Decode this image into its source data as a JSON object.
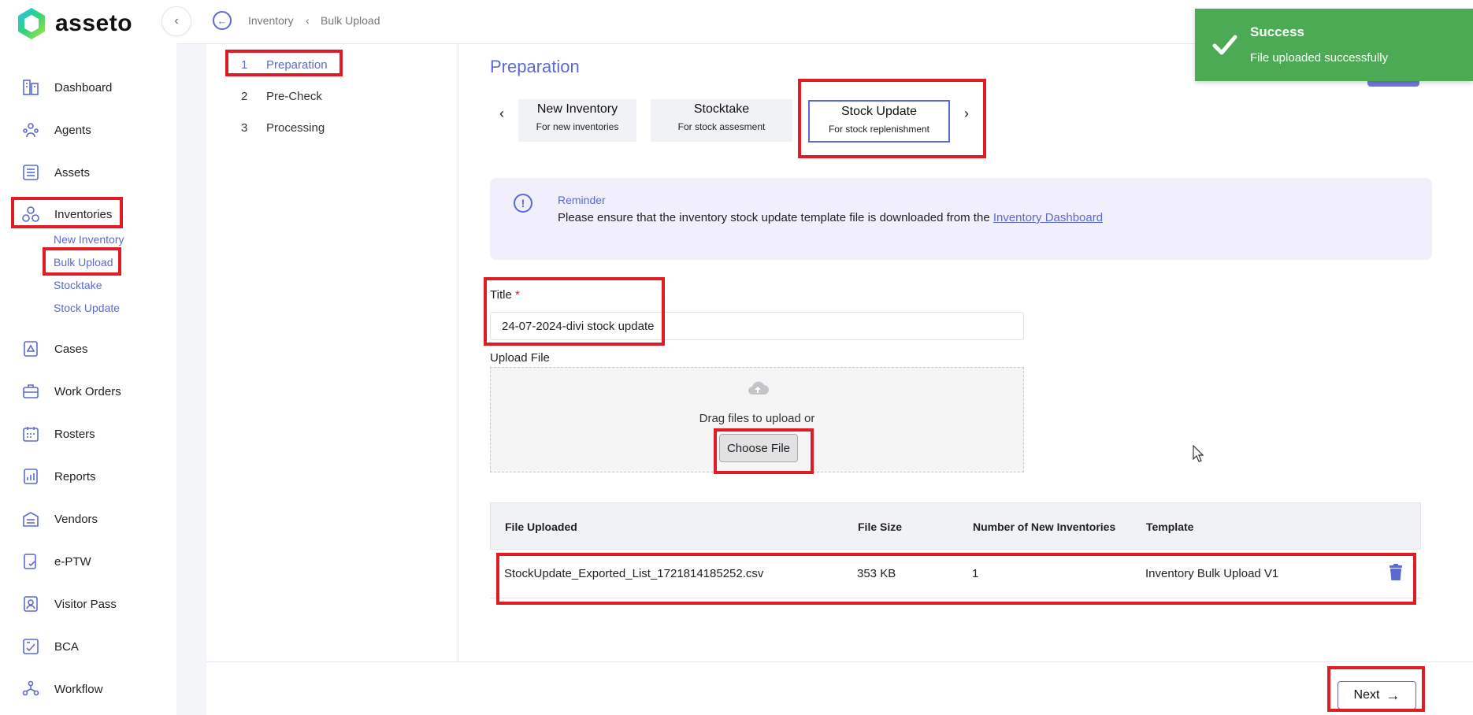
{
  "brand": {
    "name": "asseto"
  },
  "sidebar": {
    "items": [
      {
        "label": "Dashboard",
        "icon": "dashboard-icon"
      },
      {
        "label": "Agents",
        "icon": "agents-icon"
      },
      {
        "label": "Assets",
        "icon": "assets-icon"
      },
      {
        "label": "Inventories",
        "icon": "inventories-icon"
      },
      {
        "label": "Cases",
        "icon": "cases-icon"
      },
      {
        "label": "Work Orders",
        "icon": "work-orders-icon"
      },
      {
        "label": "Rosters",
        "icon": "rosters-icon"
      },
      {
        "label": "Reports",
        "icon": "reports-icon"
      },
      {
        "label": "Vendors",
        "icon": "vendors-icon"
      },
      {
        "label": "e-PTW",
        "icon": "eptw-icon"
      },
      {
        "label": "Visitor Pass",
        "icon": "visitor-pass-icon"
      },
      {
        "label": "BCA",
        "icon": "bca-icon"
      },
      {
        "label": "Workflow",
        "icon": "workflow-icon"
      }
    ],
    "inventories_sub": [
      "New Inventory",
      "Bulk Upload",
      "Stocktake",
      "Stock Update"
    ]
  },
  "breadcrumb": {
    "parent": "Inventory",
    "current": "Bulk Upload"
  },
  "steps": [
    {
      "num": "1",
      "label": "Preparation"
    },
    {
      "num": "2",
      "label": "Pre-Check"
    },
    {
      "num": "3",
      "label": "Processing"
    }
  ],
  "main": {
    "title": "Preparation",
    "tabs": [
      {
        "title": "New Inventory",
        "subtitle": "For new inventories"
      },
      {
        "title": "Stocktake",
        "subtitle": "For stock assesment"
      },
      {
        "title": "Stock Update",
        "subtitle": "For stock replenishment"
      }
    ],
    "reminder": {
      "title": "Reminder",
      "text": "Please ensure that the inventory stock update template file is downloaded from the ",
      "link": "Inventory Dashboard"
    },
    "title_label": "Title",
    "title_required": "*",
    "title_value": "24-07-2024-divi stock update",
    "upload_label": "Upload File",
    "upload_hint": "Drag files to upload or",
    "choose_file": "Choose File",
    "table": {
      "headers": [
        "File Uploaded",
        "File Size",
        "Number of New Inventories",
        "Template"
      ],
      "rows": [
        {
          "file": "StockUpdate_Exported_List_1721814185252.csv",
          "size": "353 KB",
          "count": "1",
          "template": "Inventory Bulk Upload V1"
        }
      ]
    },
    "next": "Next"
  },
  "toast": {
    "title": "Success",
    "message": "File uploaded successfully",
    "color": "#4caa55"
  },
  "colors": {
    "accent": "#5b6ad0",
    "highlight": "#e01b24"
  }
}
